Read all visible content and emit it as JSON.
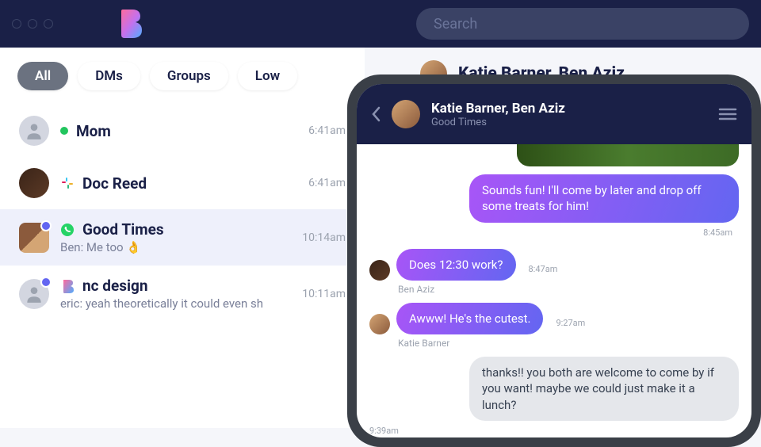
{
  "header": {
    "search_placeholder": "Search"
  },
  "filters": {
    "all": "All",
    "dms": "DMs",
    "groups": "Groups",
    "low": "Low"
  },
  "conversations": [
    {
      "name": "Mom",
      "time": "6:41am",
      "preview": ""
    },
    {
      "name": "Doc Reed",
      "time": "6:41am",
      "preview": ""
    },
    {
      "name": "Good Times",
      "time": "10:14am",
      "preview": "Ben: Me too 👌"
    },
    {
      "name": "nc design",
      "time": "10:11am",
      "preview": "eric: yeah theoretically it could even sh"
    }
  ],
  "desktop_peek": {
    "title": "Katie Barner, Ben Aziz"
  },
  "phone": {
    "title": "Katie Barner, Ben Aziz",
    "subtitle": "Good Times",
    "messages": {
      "m1": {
        "text": "Sounds fun! I'll come by later and drop off some treats for him!",
        "time": "8:45am"
      },
      "m2": {
        "text": "Does 12:30 work?",
        "time": "8:47am",
        "sender": "Ben Aziz"
      },
      "m3": {
        "text": "Awww! He's the cutest.",
        "time": "9:27am",
        "sender": "Katie Barner"
      },
      "m4": {
        "text": "thanks!! you both are welcome to come by if you want! maybe we could just make it a lunch?",
        "time": "9:39am"
      }
    }
  }
}
